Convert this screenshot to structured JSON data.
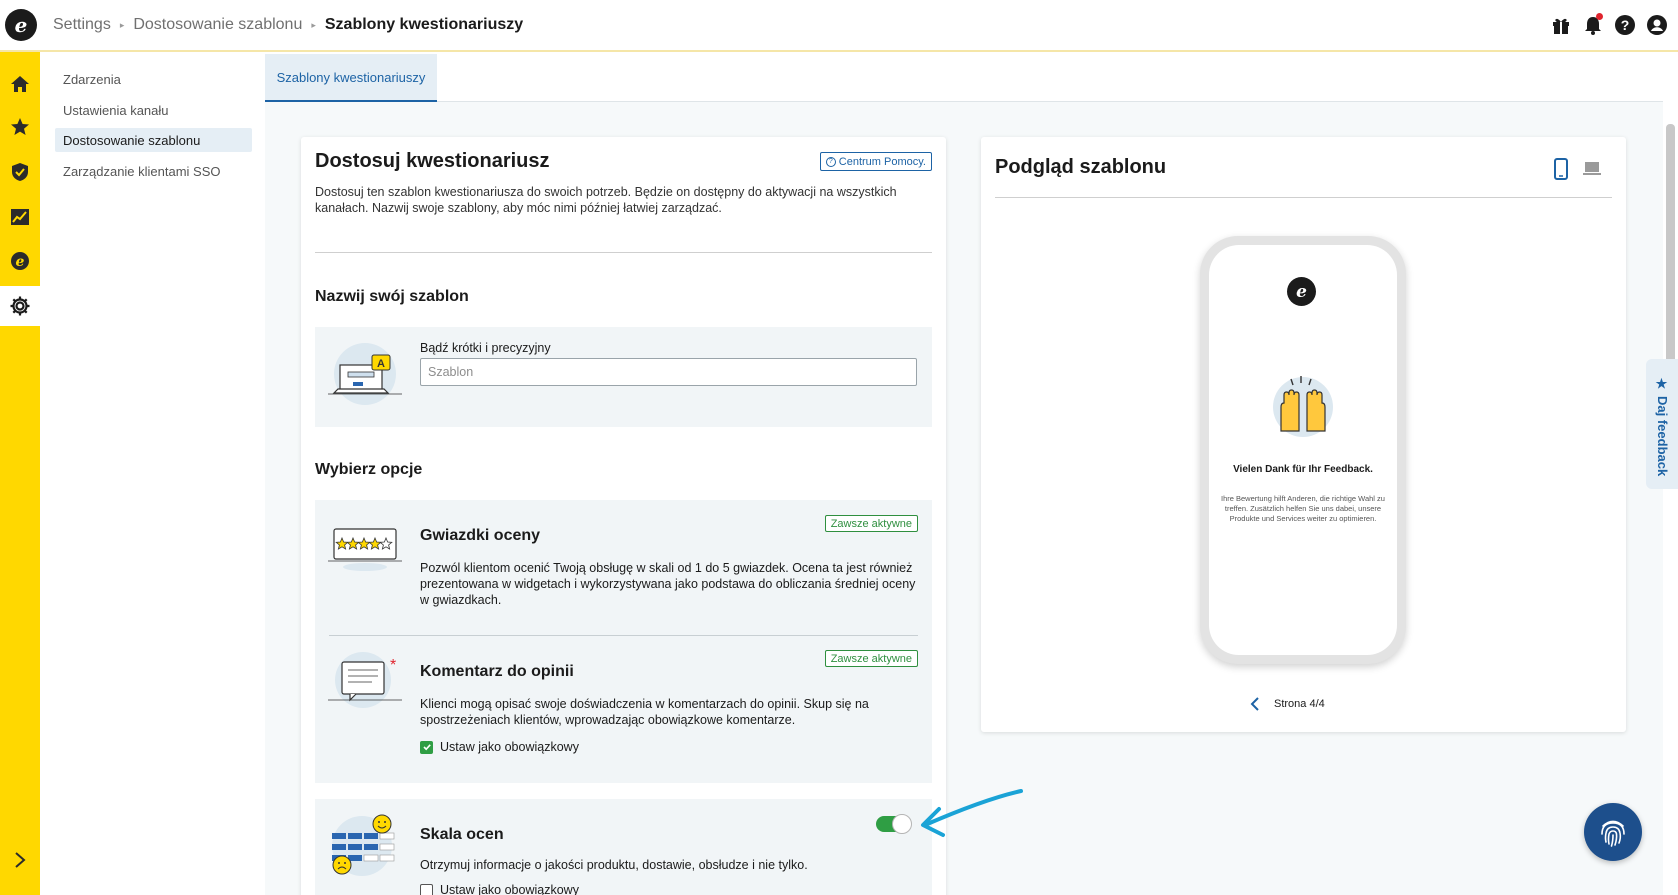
{
  "topbar": {
    "breadcrumbs": [
      "Settings",
      "Dostosowanie szablonu",
      "Szablony kwestionariuszy"
    ],
    "icons": [
      "gift-icon",
      "bell-icon",
      "help-icon",
      "account-icon"
    ]
  },
  "rail": {
    "items": [
      "home-icon",
      "star-icon",
      "shield-icon",
      "chart-icon",
      "e-icon",
      "gear-icon"
    ],
    "active": "gear-icon",
    "expand": "chevron-right-icon"
  },
  "subnav": {
    "items": [
      {
        "label": "Zdarzenia"
      },
      {
        "label": "Ustawienia kanału"
      },
      {
        "label": "Dostosowanie szablonu",
        "active": true
      },
      {
        "label": "Zarządzanie klientami SSO"
      }
    ]
  },
  "tabs": [
    {
      "label": "Szablony kwestionariuszy",
      "active": true
    }
  ],
  "editor": {
    "title": "Dostosuj kwestionariusz",
    "help_label": "Centrum Pomocy.",
    "description": "Dostosuj ten szablon kwestionariusza do swoich potrzeb. Będzie on dostępny do aktywacji na wszystkich kanałach. Nazwij swoje szablony, aby móc nimi później łatwiej zarządzać.",
    "name_section": {
      "title": "Nazwij swój szablon",
      "field_label": "Bądź krótki i precyzyjny",
      "placeholder": "Szablon",
      "value": ""
    },
    "options_title": "Wybierz opcje",
    "options": [
      {
        "title": "Gwiazdki oceny",
        "badge": "Zawsze aktywne",
        "description": "Pozwól klientom ocenić Twoją obsługę w skali od 1 do 5 gwiazdek. Ocena ta jest również prezentowana w widgetach i wykorzystywana jako podstawa do obliczania średniej oceny w gwiazdkach."
      },
      {
        "title": "Komentarz do opinii",
        "badge": "Zawsze aktywne",
        "description": "Klienci mogą opisać swoje doświadczenia w komentarzach do opinii. Skup się na spostrzeżeniach klientów, wprowadzając obowiązkowe komentarze.",
        "checkbox_label": "Ustaw jako obowiązkowy",
        "checked": true
      },
      {
        "title": "Skala ocen",
        "description": "Otrzymuj informacje o jakości produktu, dostawie, obsłudze i nie tylko.",
        "checkbox_label": "Ustaw jako obowiązkowy",
        "checked": false,
        "toggle_on": true
      }
    ]
  },
  "preview": {
    "title": "Podgląd szablonu",
    "device_icons": [
      "phone-icon",
      "laptop-icon"
    ],
    "active_device": "phone-icon",
    "phone_title": "Vielen Dank für Ihr Feedback.",
    "phone_text": "Ihre Bewertung hilft Anderen, die richtige Wahl zu treffen. Zusätzlich helfen Sie uns dabei, unsere Produkte und Services weiter zu optimieren.",
    "page_label": "Strona 4/4"
  },
  "feedback_tab": {
    "star": "★",
    "label": "Daj feedback"
  },
  "colors": {
    "rail": "#ffd800",
    "accent": "#1d63a5",
    "success": "#2f9e44",
    "annotation_arrow": "#1aa3d6"
  }
}
